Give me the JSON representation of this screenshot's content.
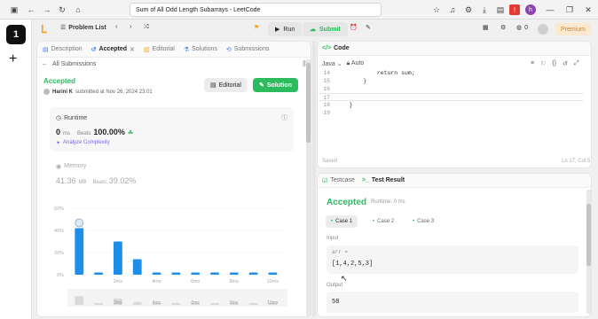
{
  "browser": {
    "url_text": "Sum of All Odd Length Subarrays - LeetCode",
    "profile_initial": "h"
  },
  "workspace": {
    "number": "1"
  },
  "topnav": {
    "problem_list": "Problem List",
    "run": "Run",
    "submit": "Submit",
    "fire_count": "0",
    "premium": "Premium"
  },
  "left": {
    "tabs": [
      {
        "label": "Description"
      },
      {
        "label": "Accepted"
      },
      {
        "label": "Editorial"
      },
      {
        "label": "Solutions"
      },
      {
        "label": "Submissions"
      }
    ],
    "all_submissions": "All Submissions",
    "status": "Accepted",
    "author": "Harini K",
    "submitted_at": "submitted at Nov 26, 2024 23:01",
    "editorial_btn": "Editorial",
    "solution_btn": "Solution",
    "runtime": {
      "label": "Runtime",
      "value": "0",
      "unit": "ms",
      "beats_label": "Beats",
      "beats_value": "100.00%",
      "analyze": "Analyze Complexity"
    },
    "memory": {
      "label": "Memory",
      "value": "41.36",
      "unit": "MB",
      "beats_label": "Beats",
      "beats_value": "39.02%"
    }
  },
  "chart_data": {
    "type": "bar",
    "x_tick_labels": [
      "2ms",
      "4ms",
      "6ms",
      "8ms",
      "10ms"
    ],
    "y_tick_labels": [
      "60%",
      "40%",
      "20%",
      "0%"
    ],
    "ylim": [
      0,
      60
    ],
    "values": [
      42,
      2,
      30,
      14,
      2,
      2,
      2,
      2,
      2,
      2,
      2
    ],
    "highlight_index": 0,
    "bar_color": "#1e8ee8",
    "mini_x_tick_labels": [
      "2ms",
      "4ms",
      "6ms",
      "8ms",
      "10ms"
    ]
  },
  "code": {
    "title": "Code",
    "language": "Java",
    "mode": "Auto",
    "lines": [
      {
        "num": "14",
        "text": "            return sum;"
      },
      {
        "num": "15",
        "text": "        }"
      },
      {
        "num": "16",
        "text": ""
      },
      {
        "num": "17",
        "text": ""
      },
      {
        "num": "18",
        "text": "    }"
      },
      {
        "num": "19",
        "text": ""
      }
    ],
    "saved": "Saved",
    "cursor": "Ln 17, Col 5"
  },
  "result": {
    "tab_testcase": "Testcase",
    "tab_result": "Test Result",
    "status": "Accepted",
    "runtime": "Runtime: 0 ms",
    "cases": [
      "Case 1",
      "Case 2",
      "Case 3"
    ],
    "input_label": "Input",
    "var_name": "arr =",
    "input_value": "[1,4,2,5,3]",
    "output_label": "Output",
    "output_value": "58"
  },
  "colors": {
    "accent_green": "#2cbb5d",
    "bar_blue": "#1e8ee8",
    "brand_orange": "#f89f1b"
  }
}
